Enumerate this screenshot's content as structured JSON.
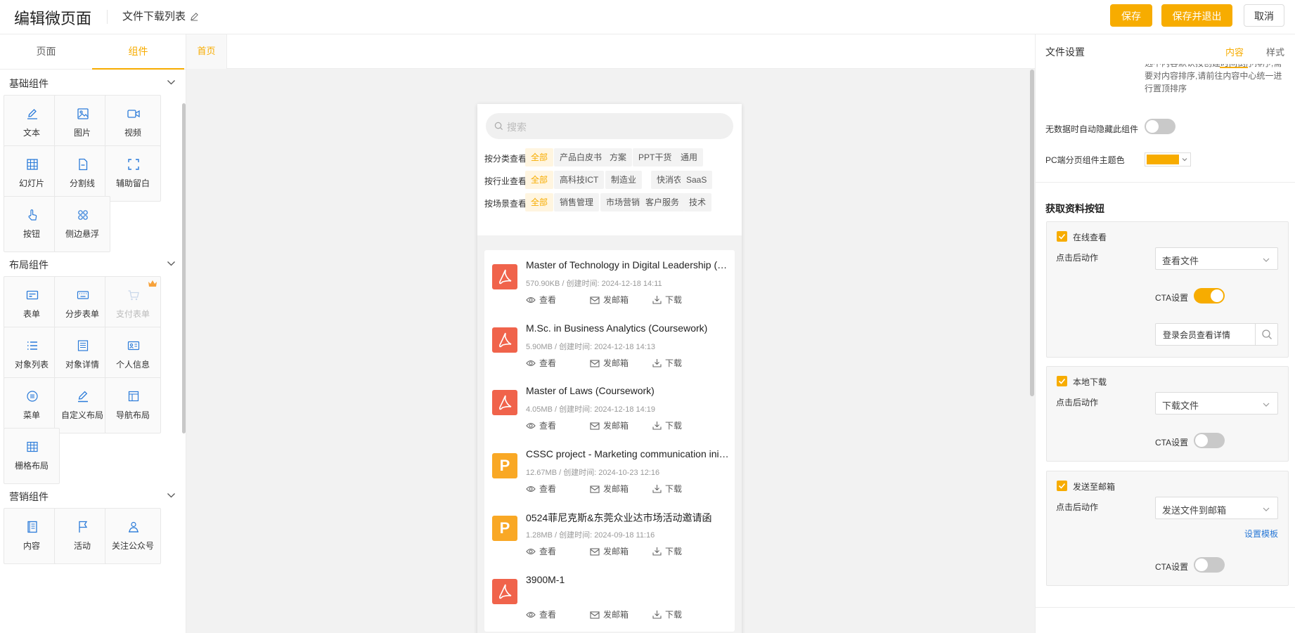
{
  "header": {
    "title": "编辑微页面",
    "page_name": "文件下载列表",
    "save": "保存",
    "save_exit": "保存并退出",
    "cancel": "取消"
  },
  "left_panel": {
    "tabs": [
      "页面",
      "组件"
    ],
    "active_tab": "组件",
    "groups": [
      {
        "title": "基础组件",
        "items": [
          {
            "label": "文本",
            "icon": "edit-icon"
          },
          {
            "label": "图片",
            "icon": "image-icon"
          },
          {
            "label": "视频",
            "icon": "video-icon"
          },
          {
            "label": "幻灯片",
            "icon": "slides-icon"
          },
          {
            "label": "分割线",
            "icon": "document-icon"
          },
          {
            "label": "辅助留白",
            "icon": "expand-icon"
          },
          {
            "label": "按钮",
            "icon": "pointer-icon"
          },
          {
            "label": "侧边悬浮",
            "icon": "grid-icon"
          }
        ]
      },
      {
        "title": "布局组件",
        "items": [
          {
            "label": "表单",
            "icon": "form-icon"
          },
          {
            "label": "分步表单",
            "icon": "keyboard-icon"
          },
          {
            "label": "支付表单",
            "icon": "cart-icon",
            "disabled": true
          },
          {
            "label": "对象列表",
            "icon": "list-icon"
          },
          {
            "label": "对象详情",
            "icon": "detail-icon"
          },
          {
            "label": "个人信息",
            "icon": "id-card-icon"
          },
          {
            "label": "菜单",
            "icon": "menu-icon"
          },
          {
            "label": "自定义布局",
            "icon": "pen-icon"
          },
          {
            "label": "导航布局",
            "icon": "layout-icon"
          },
          {
            "label": "栅格布局",
            "icon": "table-icon"
          }
        ]
      },
      {
        "title": "营销组件",
        "items": [
          {
            "label": "内容",
            "icon": "book-icon"
          },
          {
            "label": "活动",
            "icon": "flag-icon"
          },
          {
            "label": "关注公众号",
            "icon": "user-icon"
          }
        ]
      }
    ]
  },
  "canvas": {
    "tab": "首页",
    "search_placeholder": "搜索",
    "filters": [
      {
        "label": "按分类查看",
        "chips": [
          "全部",
          "产品白皮书",
          "方案",
          "PPT干货",
          "通用"
        ]
      },
      {
        "label": "按行业查看",
        "chips": [
          "全部",
          "高科技ICT",
          "制造业",
          "快消农牧",
          "SaaS"
        ]
      },
      {
        "label": "按场景查看",
        "chips": [
          "全部",
          "销售管理",
          "市场营销",
          "客户服务",
          "技术"
        ]
      }
    ],
    "files": [
      {
        "type": "pdf",
        "title": "Master of Technology in Digital Leadership (Coursework)",
        "meta": "570.90KB / 创建时间:  2024-12-18 14:11"
      },
      {
        "type": "pdf",
        "title": "M.Sc. in Business Analytics (Coursework)",
        "meta": "5.90MB / 创建时间:  2024-12-18 14:13"
      },
      {
        "type": "pdf",
        "title": "Master of Laws (Coursework)",
        "meta": "4.05MB / 创建时间:  2024-12-18 14:19"
      },
      {
        "type": "ppt",
        "title": "CSSC project - Marketing communication initiatives",
        "meta": "12.67MB / 创建时间:  2024-10-23 12:16"
      },
      {
        "type": "ppt",
        "title": "0524菲尼克斯&东莞众业达市场活动邀请函",
        "meta": "1.28MB / 创建时间:  2024-09-18 11:16"
      },
      {
        "type": "pdf",
        "title": "3900M-1",
        "meta": ""
      }
    ],
    "actions": {
      "view": "查看",
      "mail": "发邮箱",
      "download": "下载"
    }
  },
  "right_panel": {
    "title": "文件设置",
    "tabs": [
      "内容",
      "样式"
    ],
    "active_tab": "内容",
    "hint": "选中内容默认按创建时间倒序排序,需要对内容排序,请前往内容中心统一进行置顶排序",
    "auto_hide_label": "无数据时自动隐藏此组件",
    "auto_hide": false,
    "theme_color_label": "PC端分页组件主题色",
    "theme_color": "#f7ac00",
    "section_title": "获取资料按钮",
    "options": [
      {
        "checkbox": "在线查看",
        "action_label": "点击后动作",
        "action_value": "查看文件",
        "cta_label": "CTA设置",
        "cta_on": true,
        "cta_input": "登录会员查看详情"
      },
      {
        "checkbox": "本地下载",
        "action_label": "点击后动作",
        "action_value": "下载文件",
        "cta_label": "CTA设置",
        "cta_on": false
      },
      {
        "checkbox": "发送至邮箱",
        "action_label": "点击后动作",
        "action_value": "发送文件到邮箱",
        "template_link": "设置模板",
        "cta_label": "CTA设置",
        "cta_on": false
      }
    ]
  }
}
